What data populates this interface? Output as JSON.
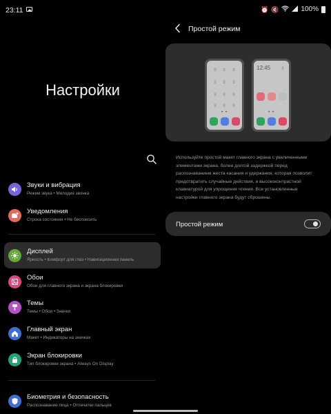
{
  "status_bar": {
    "time": "23:11",
    "battery": "100%",
    "icons": [
      "gallery-icon",
      "alarm-icon",
      "mute-icon",
      "wifi-icon",
      "signal-icon",
      "battery-icon"
    ]
  },
  "left": {
    "title": "Настройки",
    "items": [
      {
        "title": "Звуки и вибрация",
        "subtitle": "Режим звука  •  Мелодия звонка",
        "icon": "volume-icon",
        "color": "#7a63d8",
        "active": false
      },
      {
        "title": "Уведомления",
        "subtitle": "Строка состояния  •  Не беспокоить",
        "icon": "notification-icon",
        "color": "#e36b5a",
        "active": false
      },
      {
        "title": "Дисплей",
        "subtitle": "Яркость  •  Комфорт для глаз  •  Навигационная панель",
        "icon": "sun-icon",
        "color": "#62a83c",
        "active": true
      },
      {
        "title": "Обои",
        "subtitle": "Обои для главного экрана и экрана блокировки",
        "icon": "wallpaper-icon",
        "color": "#d9497c",
        "active": false
      },
      {
        "title": "Темы",
        "subtitle": "Темы  •  Обои  •  Значки",
        "icon": "brush-icon",
        "color": "#b450c8",
        "active": false
      },
      {
        "title": "Главный экран",
        "subtitle": "Макет  •  Индикаторы на значках",
        "icon": "home-icon",
        "color": "#3f6fd4",
        "active": false
      },
      {
        "title": "Экран блокировки",
        "subtitle": "Тип блокировки экрана  •  Always On Display",
        "icon": "lock-icon",
        "color": "#26a07a",
        "active": false
      },
      {
        "title": "Биометрия и безопасность",
        "subtitle": "Распознавание лица  •  Отпечатки пальцев",
        "icon": "shield-icon",
        "color": "#3f6fd4",
        "active": false
      }
    ]
  },
  "right": {
    "title": "Простой режим",
    "preview": {
      "clock": "12:45",
      "dock_colors": [
        "#2fa25d",
        "#4f7fe0",
        "#d94b62"
      ],
      "big_app_colors": [
        "#e06a7a",
        "#e08a8a",
        "#bdbdbd"
      ]
    },
    "description": "Используйте простой макет главного экрана с увеличенными элементами экрана, более долгой задержкой перед распознаванием жеста касания и удержания, которая позволит предотвратить случайные действия, и высококонтрастной клавиатурой для упрощения чтения. Все установленные настройки главного экрана будут сброшены.",
    "toggle": {
      "label": "Простой режим",
      "value": false
    }
  },
  "colors": {
    "background": "#000000",
    "card": "#2a2a2a",
    "active_row": "#2c2c2c"
  }
}
